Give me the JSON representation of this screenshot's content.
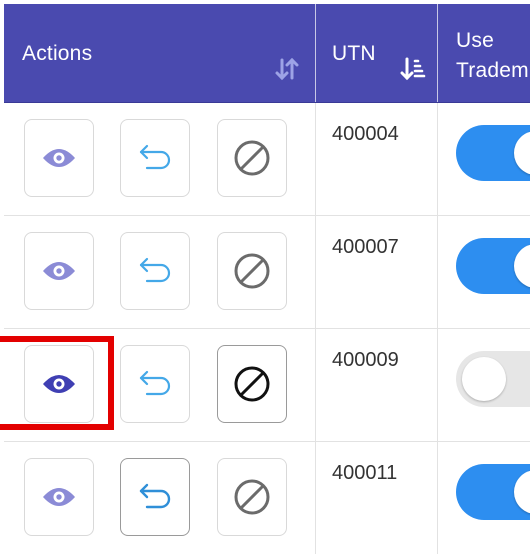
{
  "header": {
    "actions_label": "Actions",
    "utn_label": "UTN",
    "use_label_line1": "Use",
    "use_label_line2": "Tradem"
  },
  "rows": [
    {
      "utn": "400004",
      "use_trademark": true
    },
    {
      "utn": "400007",
      "use_trademark": true
    },
    {
      "utn": "400009",
      "use_trademark": false
    },
    {
      "utn": "400011",
      "use_trademark": true
    }
  ],
  "icons": {
    "view": "eye-icon",
    "undo": "undo-arrow-icon",
    "block": "block-icon",
    "sort_neutral": "sort-updown-icon",
    "sort_active": "sort-descending-icon"
  },
  "colors": {
    "header_bg": "#4a4aaf",
    "eye_default": "#8b8bd6",
    "eye_active": "#3f3fb3",
    "undo_arrow": "#44a8e8",
    "toggle_on": "#2d8ef0",
    "toggle_off": "#e6e6e6",
    "highlight": "#e30000"
  }
}
